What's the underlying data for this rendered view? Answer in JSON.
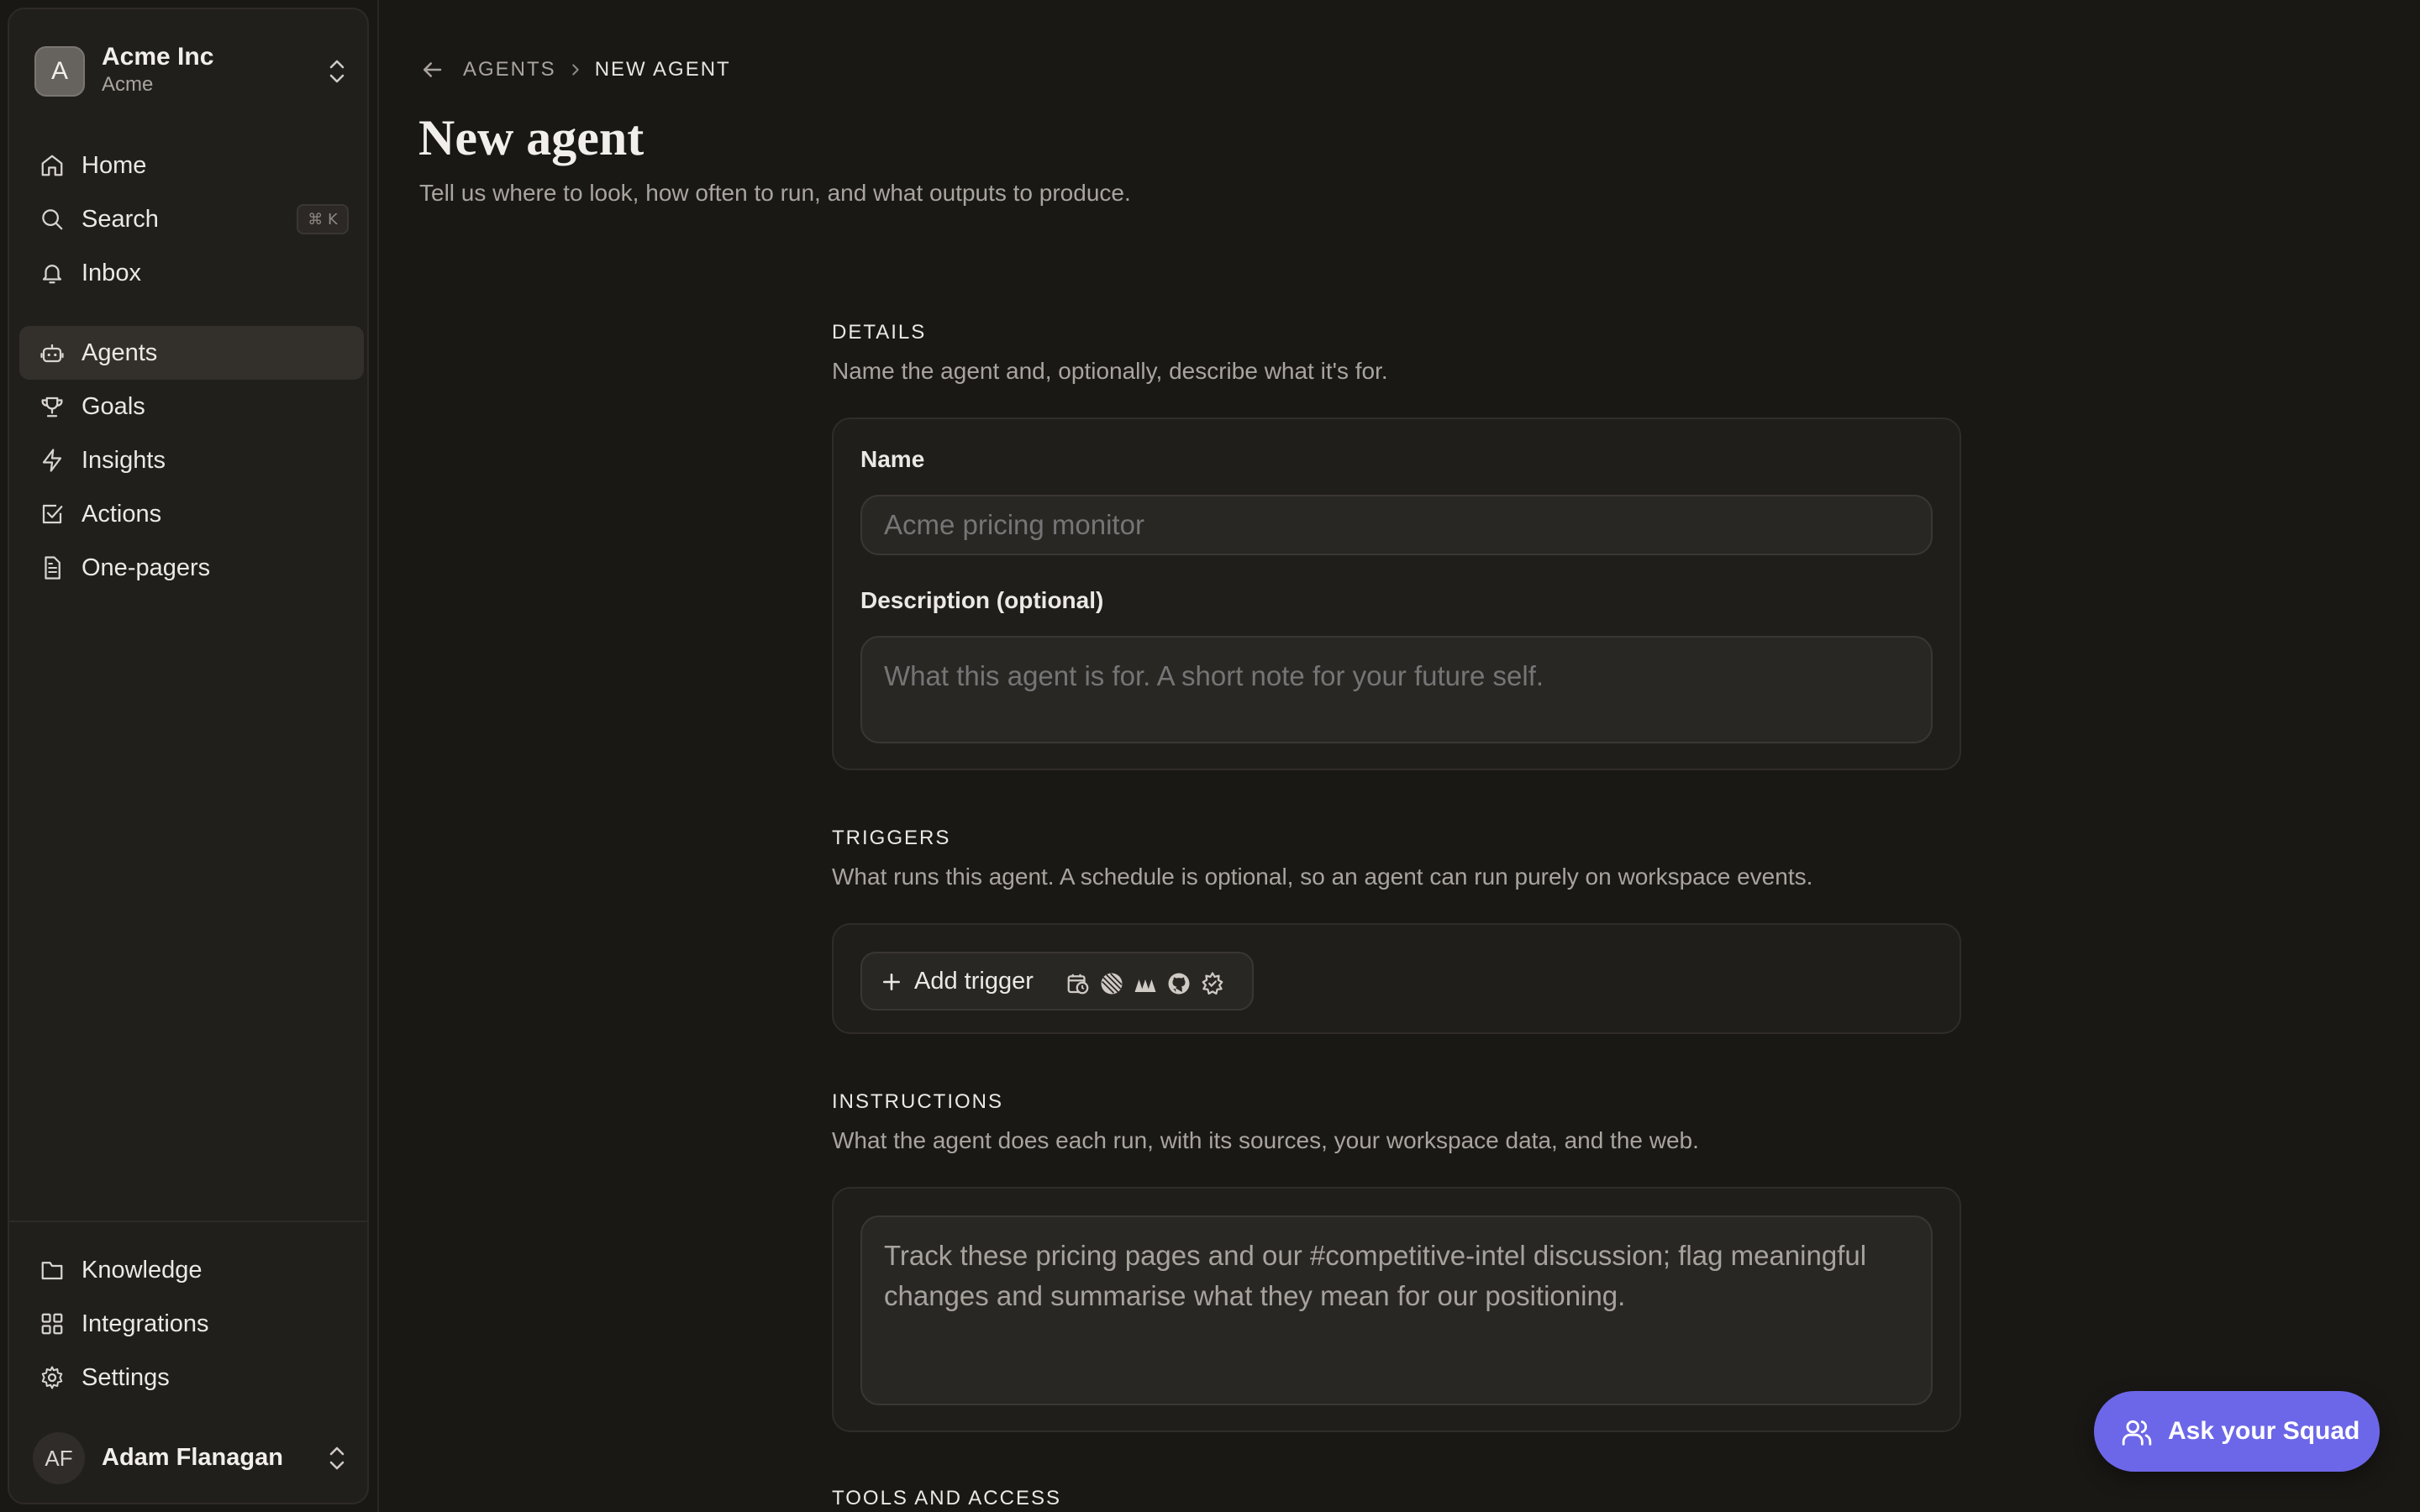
{
  "org": {
    "initial": "A",
    "name": "Acme Inc",
    "subtitle": "Acme"
  },
  "nav": {
    "home": "Home",
    "search": "Search",
    "search_shortcut": "⌘ K",
    "inbox": "Inbox",
    "agents": "Agents",
    "goals": "Goals",
    "insights": "Insights",
    "actions": "Actions",
    "one_pagers": "One-pagers",
    "knowledge": "Knowledge",
    "integrations": "Integrations",
    "settings": "Settings"
  },
  "user": {
    "initials": "AF",
    "name": "Adam Flanagan"
  },
  "breadcrumb": {
    "parent": "AGENTS",
    "current": "NEW AGENT"
  },
  "page": {
    "title": "New agent",
    "subtitle": "Tell us where to look, how often to run, and what outputs to produce."
  },
  "details": {
    "heading": "DETAILS",
    "description": "Name the agent and, optionally, describe what it's for.",
    "name_label": "Name",
    "name_placeholder": "Acme pricing monitor",
    "description_label": "Description (optional)",
    "description_placeholder": "What this agent is for. A short note for your future self."
  },
  "triggers": {
    "heading": "TRIGGERS",
    "description": "What runs this agent. A schedule is optional, so an agent can run purely on workspace events.",
    "add_label": "Add trigger",
    "icons": [
      "schedule-icon",
      "linear-icon",
      "stripe-icon",
      "github-icon",
      "webhook-icon"
    ]
  },
  "instructions": {
    "heading": "INSTRUCTIONS",
    "description": "What the agent does each run, with its sources, your workspace data, and the web.",
    "value": "Track these pricing pages and our #competitive-intel discussion; flag meaningful changes and summarise what they mean for our positioning."
  },
  "tools": {
    "heading": "TOOLS AND ACCESS"
  },
  "ask_button": {
    "label": "Ask your Squad"
  },
  "colors": {
    "accent": "#6c67e8",
    "background": "#1a1815",
    "sidebar": "#211f1c"
  }
}
